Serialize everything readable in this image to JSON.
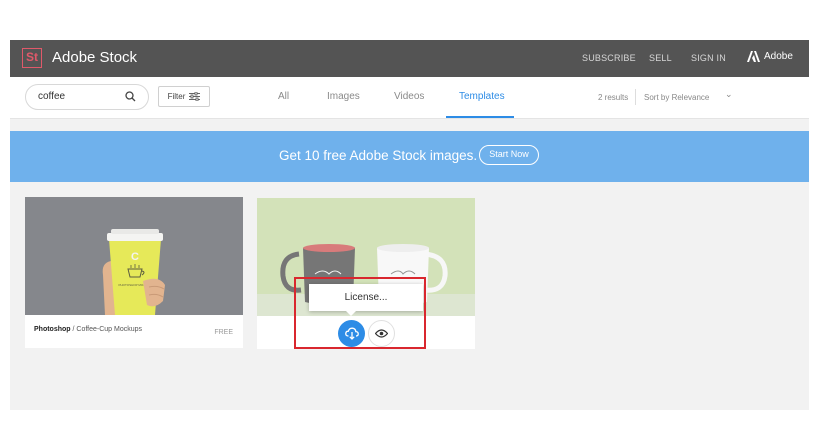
{
  "header": {
    "logo_mark": "St",
    "brand": "Adobe Stock",
    "nav": [
      "SUBSCRIBE",
      "SELL",
      "SIGN IN"
    ],
    "adobe_label": "Adobe"
  },
  "toolbar": {
    "search_value": "coffee",
    "filter_label": "Filter",
    "tabs": [
      "All",
      "Images",
      "Videos",
      "Templates"
    ],
    "active_tab": "Templates",
    "results": "2 results",
    "sort_label": "Sort by Relevance"
  },
  "banner": {
    "text": "Get 10 free Adobe Stock images.",
    "button": "Start Now"
  },
  "cards": [
    {
      "app": "Photoshop",
      "title": "/ Coffee-Cup Mockups",
      "price": "FREE",
      "cup_letter_top": "C",
      "cup_caption": "PHOTOSHOP MOCKUP"
    },
    {
      "tooltip": "License..."
    }
  ],
  "colors": {
    "header_bg": "#545454",
    "accent": "#2d8ce6",
    "banner_bg": "#6fb1ec",
    "logo": "#e0596a",
    "highlight": "#d9272e"
  }
}
